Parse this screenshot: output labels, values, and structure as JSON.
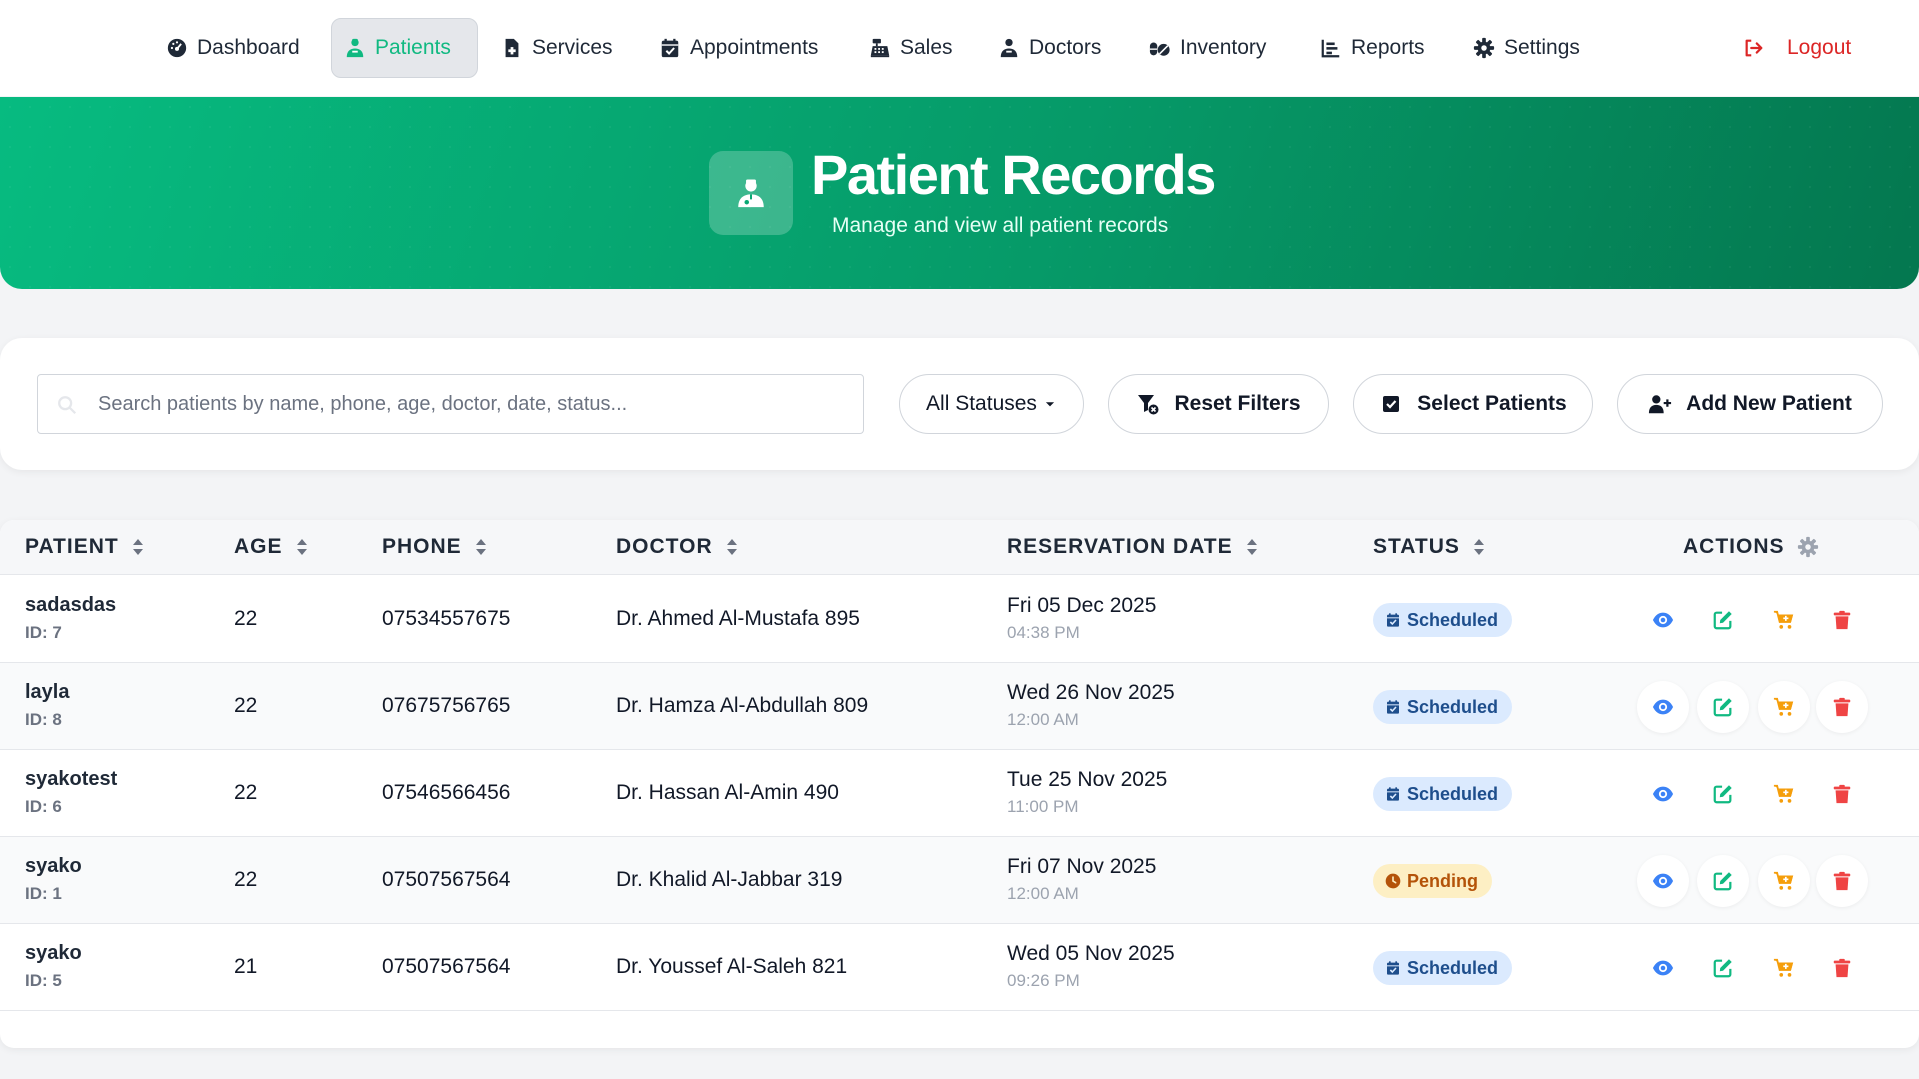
{
  "nav": {
    "items": [
      {
        "label": "Dashboard",
        "icon": "gauge-icon"
      },
      {
        "label": "Patients",
        "icon": "user-doctor-icon"
      },
      {
        "label": "Services",
        "icon": "file-medical-icon"
      },
      {
        "label": "Appointments",
        "icon": "calendar-check-icon"
      },
      {
        "label": "Sales",
        "icon": "cash-register-icon"
      },
      {
        "label": "Doctors",
        "icon": "user-doctor-icon"
      },
      {
        "label": "Inventory",
        "icon": "pills-icon"
      },
      {
        "label": "Reports",
        "icon": "chart-bar-icon"
      },
      {
        "label": "Settings",
        "icon": "gear-icon"
      }
    ],
    "active": "Patients",
    "logout_label": "Logout"
  },
  "hero": {
    "title": "Patient Records",
    "subtitle": "Manage and view all patient records"
  },
  "filters": {
    "search_placeholder": "Search patients by name, phone, age, doctor, date, status...",
    "search_value": "",
    "status_select": "All Statuses",
    "reset_label": "Reset Filters",
    "select_label": "Select Patients",
    "add_label": "Add New Patient"
  },
  "table": {
    "headers": {
      "patient": "PATIENT",
      "age": "AGE",
      "phone": "PHONE",
      "doctor": "DOCTOR",
      "date": "RESERVATION DATE",
      "status": "STATUS",
      "actions": "ACTIONS"
    },
    "rows": [
      {
        "name": "sadasdas",
        "id": "ID: 7",
        "age": "22",
        "phone": "07534557675",
        "doctor": "Dr. Ahmed Al-Mustafa 895",
        "date": "Fri 05 Dec 2025",
        "time": "04:38 PM",
        "status": "Scheduled"
      },
      {
        "name": "layla",
        "id": "ID: 8",
        "age": "22",
        "phone": "07675756765",
        "doctor": "Dr. Hamza Al-Abdullah 809",
        "date": "Wed 26 Nov 2025",
        "time": "12:00 AM",
        "status": "Scheduled"
      },
      {
        "name": "syakotest",
        "id": "ID: 6",
        "age": "22",
        "phone": "07546566456",
        "doctor": "Dr. Hassan Al-Amin 490",
        "date": "Tue 25 Nov 2025",
        "time": "11:00 PM",
        "status": "Scheduled"
      },
      {
        "name": "syako",
        "id": "ID: 1",
        "age": "22",
        "phone": "07507567564",
        "doctor": "Dr. Khalid Al-Jabbar 319",
        "date": "Fri 07 Nov 2025",
        "time": "12:00 AM",
        "status": "Pending"
      },
      {
        "name": "syako",
        "id": "ID: 5",
        "age": "21",
        "phone": "07507567564",
        "doctor": "Dr. Youssef Al-Saleh 821",
        "date": "Wed 05 Nov 2025",
        "time": "09:26 PM",
        "status": "Scheduled"
      }
    ]
  },
  "colors": {
    "accent": "#10b981",
    "hero_start": "#07bb80",
    "hero_end": "#04774f",
    "logout": "#dc2626",
    "view": "#3b82f6",
    "edit": "#10b981",
    "cart": "#f59e0b",
    "delete": "#ef4444",
    "scheduled_bg": "#dbeafe",
    "pending_bg": "#fdefc4"
  }
}
